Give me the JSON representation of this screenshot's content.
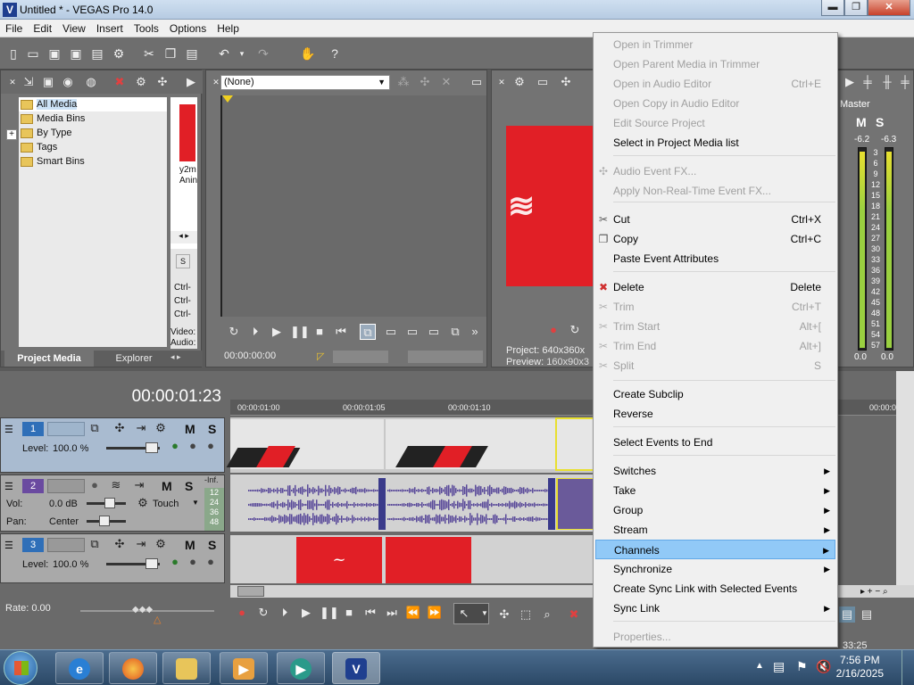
{
  "window": {
    "title": "Untitled * - VEGAS Pro 14.0",
    "logo": "V",
    "min": "▬",
    "max": "❐",
    "close": "✕"
  },
  "menu": [
    "File",
    "Edit",
    "View",
    "Insert",
    "Tools",
    "Options",
    "Help"
  ],
  "project_media": {
    "tree": [
      "All Media",
      "Media Bins",
      "By Type",
      "Tags",
      "Smart Bins"
    ],
    "thumb_caption": "y2m\nAnin",
    "bottom_labels": [
      "Ctrl-",
      "Ctrl-",
      "Ctrl-"
    ],
    "props": [
      "Video:",
      "Audio:"
    ],
    "tab_active": "Project Media",
    "tab_other": "Explorer"
  },
  "trimmer": {
    "dropdown": "(None)",
    "time": "00:00:00:00"
  },
  "preview": {
    "project_label": "Project:",
    "project_value": "640x360x",
    "preview_label": "Preview:",
    "preview_value": "160x90x3"
  },
  "master": {
    "title": "Master",
    "m": "M",
    "s": "S",
    "left_peak": "-6.2",
    "right_peak": "-6.3",
    "scale": [
      "3",
      "6",
      "9",
      "12",
      "15",
      "18",
      "21",
      "24",
      "27",
      "30",
      "33",
      "36",
      "39",
      "42",
      "45",
      "48",
      "51",
      "54",
      "57"
    ],
    "bottom_left": "0.0",
    "bottom_right": "0.0"
  },
  "timeline": {
    "timecode": "00:00:01:23",
    "ruler": [
      "00:00:01:00",
      "00:00:01:05",
      "00:00:01:10",
      "00:00:0"
    ],
    "track1": {
      "num": "1",
      "level_label": "Level:",
      "level_value": "100.0 %",
      "m": "M",
      "s": "S"
    },
    "track2": {
      "num": "2",
      "vol_label": "Vol:",
      "vol_value": "0.0 dB",
      "pan_label": "Pan:",
      "pan_value": "Center",
      "touch": "Touch",
      "m": "M",
      "s": "S",
      "inf": "-Inf.",
      "meter": [
        "12",
        "24",
        "36",
        "48"
      ]
    },
    "track3": {
      "num": "3",
      "level_label": "Level:",
      "level_value": "100.0 %",
      "m": "M",
      "s": "S"
    },
    "rate": "Rate: 0.00",
    "end_time": "33:25"
  },
  "context_menu": [
    {
      "label": "Open in Trimmer",
      "shortcut": "",
      "disabled": true
    },
    {
      "label": "Open Parent Media in Trimmer",
      "shortcut": "",
      "disabled": true
    },
    {
      "label": "Open in Audio Editor",
      "shortcut": "Ctrl+E",
      "disabled": true
    },
    {
      "label": "Open Copy in Audio Editor",
      "shortcut": "",
      "disabled": true
    },
    {
      "label": "Edit Source Project",
      "shortcut": "",
      "disabled": true
    },
    {
      "label": "Select in Project Media list",
      "shortcut": "",
      "disabled": false
    },
    {
      "label": "Audio Event FX...",
      "shortcut": "",
      "disabled": true
    },
    {
      "label": "Apply Non-Real-Time Event FX...",
      "shortcut": "",
      "disabled": true
    },
    {
      "label": "Cut",
      "shortcut": "Ctrl+X",
      "disabled": false
    },
    {
      "label": "Copy",
      "shortcut": "Ctrl+C",
      "disabled": false
    },
    {
      "label": "Paste Event Attributes",
      "shortcut": "",
      "disabled": false
    },
    {
      "label": "Delete",
      "shortcut": "Delete",
      "disabled": false
    },
    {
      "label": "Trim",
      "shortcut": "Ctrl+T",
      "disabled": true
    },
    {
      "label": "Trim Start",
      "shortcut": "Alt+[",
      "disabled": true
    },
    {
      "label": "Trim End",
      "shortcut": "Alt+]",
      "disabled": true
    },
    {
      "label": "Split",
      "shortcut": "S",
      "disabled": true
    },
    {
      "label": "Create Subclip",
      "shortcut": "",
      "disabled": false
    },
    {
      "label": "Reverse",
      "shortcut": "",
      "disabled": false
    },
    {
      "label": "Select Events to End",
      "shortcut": "",
      "disabled": false
    },
    {
      "label": "Switches",
      "shortcut": "",
      "disabled": false,
      "submenu": true
    },
    {
      "label": "Take",
      "shortcut": "",
      "disabled": false,
      "submenu": true
    },
    {
      "label": "Group",
      "shortcut": "",
      "disabled": false,
      "submenu": true
    },
    {
      "label": "Stream",
      "shortcut": "",
      "disabled": false,
      "submenu": true
    },
    {
      "label": "Channels",
      "shortcut": "",
      "disabled": false,
      "submenu": true,
      "highlighted": true
    },
    {
      "label": "Synchronize",
      "shortcut": "",
      "disabled": false,
      "submenu": true
    },
    {
      "label": "Create Sync Link with Selected Events",
      "shortcut": "",
      "disabled": false
    },
    {
      "label": "Sync Link",
      "shortcut": "",
      "disabled": false,
      "submenu": true
    },
    {
      "label": "Properties...",
      "shortcut": "",
      "disabled": true
    }
  ],
  "taskbar": {
    "time": "7:56 PM",
    "date": "2/16/2025"
  },
  "colors": {
    "highlight": "#91c9f7",
    "clip_red": "#e11f26",
    "audio_wave": "#5a4a9a",
    "track_blue": "#2f6fb8",
    "track_purple": "#6a4aa0"
  }
}
